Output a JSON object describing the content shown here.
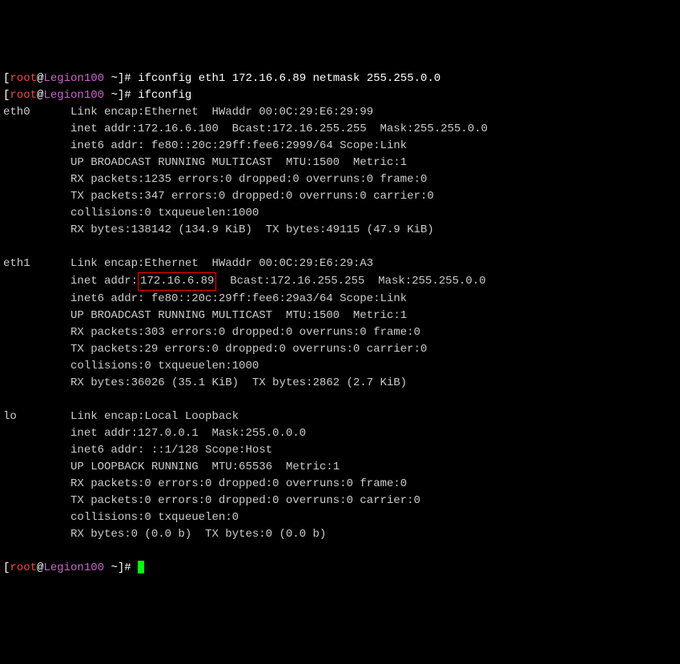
{
  "prompt": {
    "open_bracket": "[",
    "user": "root",
    "at": "@",
    "hostname": "Legion100",
    "path": " ~",
    "close_bracket": "]",
    "hash": "# "
  },
  "commands": {
    "cmd1": "ifconfig eth1 172.16.6.89 netmask 255.255.0.0",
    "cmd2": "ifconfig"
  },
  "eth0": {
    "name": "eth0      ",
    "line1": "Link encap:Ethernet  HWaddr 00:0C:29:E6:29:99",
    "line2": "          inet addr:172.16.6.100  Bcast:172.16.255.255  Mask:255.255.0.0",
    "line3": "          inet6 addr: fe80::20c:29ff:fee6:2999/64 Scope:Link",
    "line4": "          UP BROADCAST RUNNING MULTICAST  MTU:1500  Metric:1",
    "line5": "          RX packets:1235 errors:0 dropped:0 overruns:0 frame:0",
    "line6": "          TX packets:347 errors:0 dropped:0 overruns:0 carrier:0",
    "line7": "          collisions:0 txqueuelen:1000",
    "line8": "          RX bytes:138142 (134.9 KiB)  TX bytes:49115 (47.9 KiB)"
  },
  "eth1": {
    "name": "eth1      ",
    "line1": "Link encap:Ethernet  HWaddr 00:0C:29:E6:29:A3",
    "line2_prefix": "          inet addr:",
    "line2_highlight": "172.16.6.89",
    "line2_suffix": "  Bcast:172.16.255.255  Mask:255.255.0.0",
    "line3": "          inet6 addr: fe80::20c:29ff:fee6:29a3/64 Scope:Link",
    "line4": "          UP BROADCAST RUNNING MULTICAST  MTU:1500  Metric:1",
    "line5": "          RX packets:303 errors:0 dropped:0 overruns:0 frame:0",
    "line6": "          TX packets:29 errors:0 dropped:0 overruns:0 carrier:0",
    "line7": "          collisions:0 txqueuelen:1000",
    "line8": "          RX bytes:36026 (35.1 KiB)  TX bytes:2862 (2.7 KiB)"
  },
  "lo": {
    "name": "lo        ",
    "line1": "Link encap:Local Loopback",
    "line2": "          inet addr:127.0.0.1  Mask:255.0.0.0",
    "line3": "          inet6 addr: ::1/128 Scope:Host",
    "line4": "          UP LOOPBACK RUNNING  MTU:65536  Metric:1",
    "line5": "          RX packets:0 errors:0 dropped:0 overruns:0 frame:0",
    "line6": "          TX packets:0 errors:0 dropped:0 overruns:0 carrier:0",
    "line7": "          collisions:0 txqueuelen:0",
    "line8": "          RX bytes:0 (0.0 b)  TX bytes:0 (0.0 b)"
  }
}
